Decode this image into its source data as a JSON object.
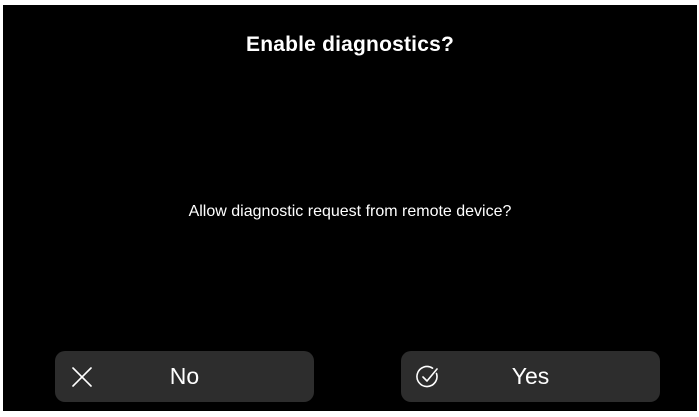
{
  "dialog": {
    "title": "Enable diagnostics?",
    "message": "Allow diagnostic request from remote device?"
  },
  "buttons": {
    "no": {
      "label": "No",
      "icon": "close-icon"
    },
    "yes": {
      "label": "Yes",
      "icon": "check-circle-icon"
    }
  },
  "colors": {
    "background": "#000000",
    "text": "#ffffff",
    "button_background": "#2d2d2d"
  }
}
